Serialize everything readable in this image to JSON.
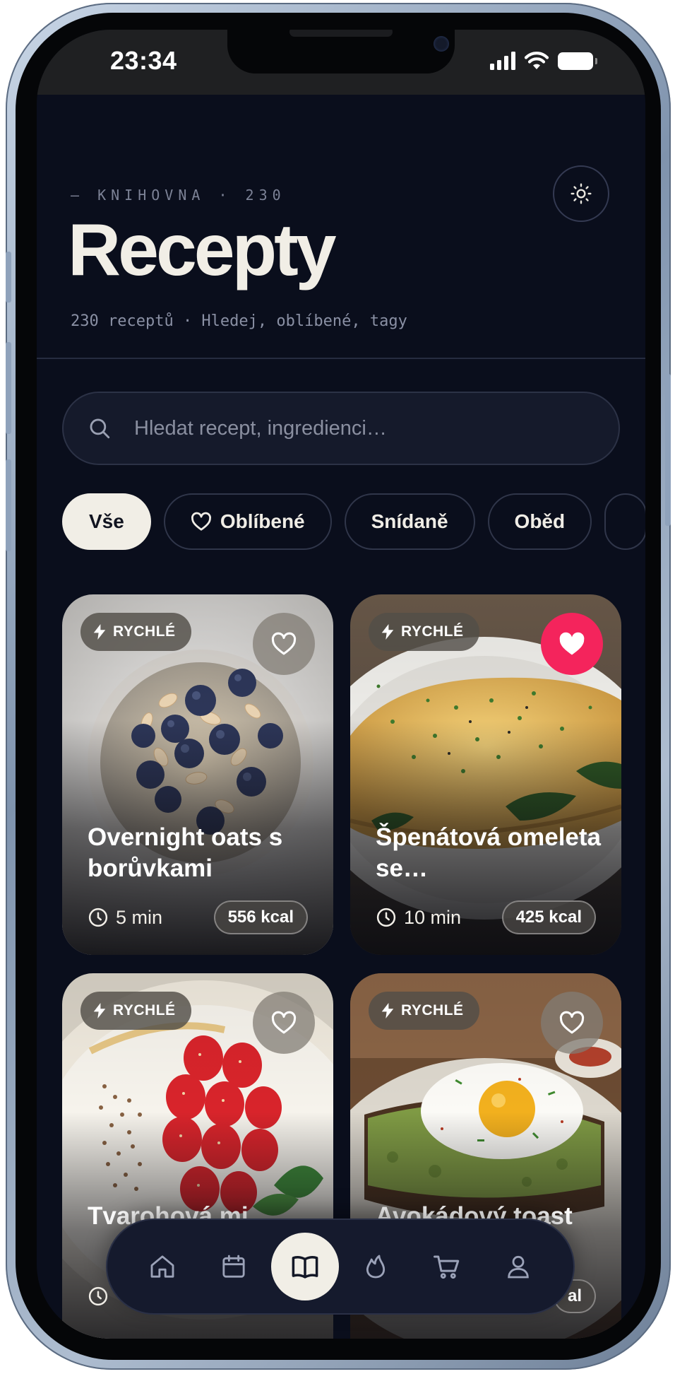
{
  "status_bar": {
    "time": "23:34"
  },
  "header": {
    "kicker": "— KNIHOVNA · 230",
    "title": "Recepty",
    "subtitle": "230 receptů · Hledej, oblíbené, tagy",
    "theme_toggle_icon": "sun-icon"
  },
  "search": {
    "placeholder": "Hledat recept, ingredienci…",
    "value": ""
  },
  "filters": [
    {
      "label": "Vše",
      "active": true
    },
    {
      "label": "Oblíbené",
      "icon": "heart-outline-icon"
    },
    {
      "label": "Snídaně"
    },
    {
      "label": "Oběd"
    }
  ],
  "recipes": [
    {
      "badge": "RYCHLÉ",
      "title": "Overnight oats s borůvkami",
      "time": "5 min",
      "kcal": "556 kcal",
      "favorite": false
    },
    {
      "badge": "RYCHLÉ",
      "title": "Špenátová omeleta se…",
      "time": "10 min",
      "kcal": "425 kcal",
      "favorite": true
    },
    {
      "badge": "RYCHLÉ",
      "title": "Tvarohová mi…",
      "favorite": false
    },
    {
      "badge": "RYCHLÉ",
      "title": "Avokádový toast",
      "kcal_partial": "al",
      "favorite": false
    }
  ],
  "nav": [
    {
      "icon": "home-icon"
    },
    {
      "icon": "calendar-icon"
    },
    {
      "icon": "book-icon",
      "active": true
    },
    {
      "icon": "flame-icon"
    },
    {
      "icon": "cart-icon"
    },
    {
      "icon": "user-icon"
    }
  ],
  "colors": {
    "background": "#0a0e1c",
    "text_primary": "#f1eee6",
    "accent_favorite": "#f4245c",
    "chip_active": "#f1eee6"
  }
}
